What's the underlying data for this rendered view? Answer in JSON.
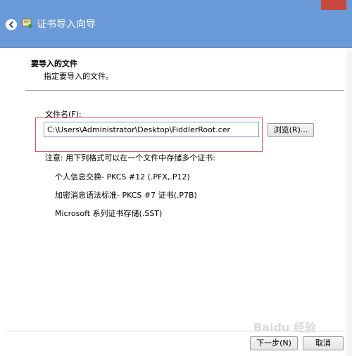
{
  "window": {
    "title": "证书导入向导",
    "titlebar_color": "#6a9bd8"
  },
  "section": {
    "title": "要导入的文件",
    "description": "指定要导入的文件。"
  },
  "file": {
    "label": "文件名(F):",
    "value": "C:\\Users\\Administrator\\Desktop\\FiddlerRoot.cer",
    "browse_label": "浏览(R)..."
  },
  "note": {
    "label": "注意: 用下列格式可以在一个文件中存储多个证书:",
    "formats": [
      "个人信息交换- PKCS #12 (.PFX,.P12)",
      "加密消息语法标准- PKCS #7 证书(.P7B)",
      "Microsoft 系列证书存储(.SST)"
    ]
  },
  "footer": {
    "next_label": "下一步(N)",
    "cancel_label": "取消"
  },
  "watermark": "Baidu 经验",
  "icons": {
    "back": "back-arrow-icon",
    "wizard": "certificate-icon"
  },
  "highlight_color": "#e05555"
}
